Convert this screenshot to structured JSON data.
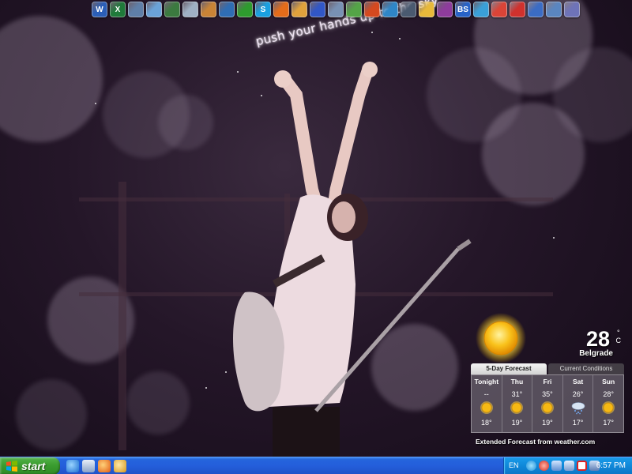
{
  "wallpaper": {
    "caption": "push your hands up to the sky"
  },
  "dock": {
    "icons": [
      {
        "name": "word-icon",
        "glyph": "W",
        "color": "#2b5fb8"
      },
      {
        "name": "excel-icon",
        "glyph": "X",
        "color": "#1f7a3a"
      },
      {
        "name": "my-computer-icon",
        "glyph": "",
        "color": "#5f7fa8"
      },
      {
        "name": "paint-icon",
        "glyph": "",
        "color": "#6aa3d8"
      },
      {
        "name": "desktop-icon",
        "glyph": "",
        "color": "#3b7a3f"
      },
      {
        "name": "cd-burner-icon",
        "glyph": "",
        "color": "#9fb1c4"
      },
      {
        "name": "network-icon",
        "glyph": "",
        "color": "#c98436"
      },
      {
        "name": "briefcase-icon",
        "glyph": "",
        "color": "#2f6db4"
      },
      {
        "name": "clover-icon",
        "glyph": "",
        "color": "#2e9b2e"
      },
      {
        "name": "skype-icon",
        "glyph": "S",
        "color": "#1aa0e0"
      },
      {
        "name": "media-player-icon",
        "glyph": "",
        "color": "#e46c1a"
      },
      {
        "name": "paint-brush-icon",
        "glyph": "",
        "color": "#e0a23c"
      },
      {
        "name": "messenger-icon",
        "glyph": "",
        "color": "#3157c7"
      },
      {
        "name": "search-icon",
        "glyph": "",
        "color": "#7891b4"
      },
      {
        "name": "recycle-icon",
        "glyph": "",
        "color": "#54a447"
      },
      {
        "name": "firefox-icon",
        "glyph": "",
        "color": "#d5491f"
      },
      {
        "name": "globe-icon",
        "glyph": "",
        "color": "#2f86c7"
      },
      {
        "name": "settings-icon",
        "glyph": "",
        "color": "#4a5a70"
      },
      {
        "name": "archive-icon",
        "glyph": "",
        "color": "#e8b93a"
      },
      {
        "name": "books-icon",
        "glyph": "",
        "color": "#8e3c9c"
      },
      {
        "name": "bs-player-icon",
        "glyph": "BS",
        "color": "#2763c8"
      },
      {
        "name": "pencil-icon",
        "glyph": "",
        "color": "#3aa0d8"
      },
      {
        "name": "chrome-icon",
        "glyph": "",
        "color": "#db4437"
      },
      {
        "name": "opera-icon",
        "glyph": "",
        "color": "#d0312d"
      },
      {
        "name": "document-icon",
        "glyph": "",
        "color": "#3b6cc4"
      },
      {
        "name": "tools-icon",
        "glyph": "",
        "color": "#5a86c0"
      },
      {
        "name": "box-icon",
        "glyph": "",
        "color": "#6e73b8"
      }
    ]
  },
  "weather": {
    "temperature": "28",
    "unit_degree": "°",
    "unit_scale": "C",
    "city": "Belgrade",
    "tabs": {
      "forecast": "5-Day Forecast",
      "current": "Current Conditions"
    },
    "days": [
      {
        "name": "Tonight",
        "high": "--",
        "low": "18°",
        "icon": "sun-icon"
      },
      {
        "name": "Thu",
        "high": "31°",
        "low": "19°",
        "icon": "sun-icon"
      },
      {
        "name": "Fri",
        "high": "35°",
        "low": "19°",
        "icon": "sun-icon"
      },
      {
        "name": "Sat",
        "high": "26°",
        "low": "17°",
        "icon": "snow-cloud-icon"
      },
      {
        "name": "Sun",
        "high": "28°",
        "low": "17°",
        "icon": "sun-icon"
      }
    ],
    "extended_link": "Extended Forecast from weather.com"
  },
  "taskbar": {
    "start_label": "start",
    "language": "EN",
    "clock": "6:57 PM",
    "colors": {
      "taskbar": "#245edb",
      "start": "#3a9c2f",
      "tray": "#0f87d8"
    }
  }
}
